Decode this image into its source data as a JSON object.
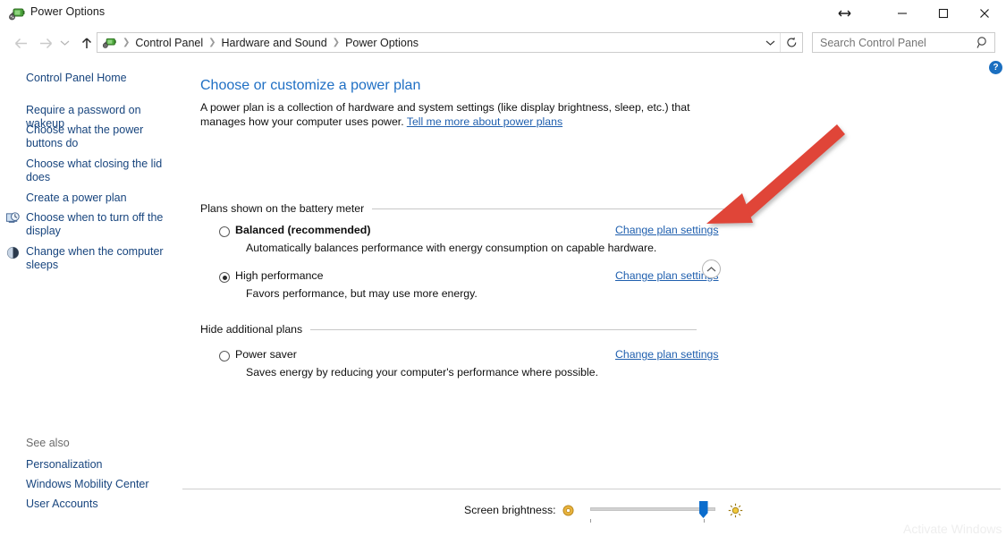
{
  "window": {
    "title": "Power Options",
    "title_icon": "power-plug-battery-icon",
    "caption": {
      "resize_label": "↔",
      "minimize_label": "—",
      "maximize_label": "□",
      "close_label": "✕"
    }
  },
  "nav": {
    "back_label": "←",
    "forward_label": "→",
    "recent_label": "⌄",
    "up_label": "↑",
    "breadcrumbs": [
      "Control Panel",
      "Hardware and Sound",
      "Power Options"
    ],
    "separator": "❯",
    "dropdown_label": "⌄",
    "refresh_label": "↻"
  },
  "search": {
    "placeholder": "Search Control Panel",
    "value": "",
    "icon": "search-icon"
  },
  "help": {
    "label": "?"
  },
  "sidebar": {
    "home_label": "Control Panel Home",
    "items": [
      {
        "label": "Require a password on wakeup",
        "icon": null
      },
      {
        "label": "Choose what the power buttons do",
        "icon": null
      },
      {
        "label": "Choose what closing the lid does",
        "icon": null
      },
      {
        "label": "Create a power plan",
        "icon": null
      },
      {
        "label": "Choose when to turn off the display",
        "icon": "monitor-clock-icon"
      },
      {
        "label": "Change when the computer sleeps",
        "icon": "moon-sleep-icon"
      }
    ],
    "see_also_label": "See also",
    "see_also_items": [
      "Personalization",
      "Windows Mobility Center",
      "User Accounts"
    ]
  },
  "main": {
    "title": "Choose or customize a power plan",
    "intro_text": "A power plan is a collection of hardware and system settings (like display brightness, sleep, etc.) that manages how your computer uses power. ",
    "intro_link": "Tell me more about power plans",
    "group_battery_label": "Plans shown on the battery meter",
    "group_additional_label": "Hide additional plans",
    "collapse_icon": "chevron-up-icon",
    "change_link_label": "Change plan settings",
    "plans": [
      {
        "name": "Balanced (recommended)",
        "description": "Automatically balances performance with energy consumption on capable hardware.",
        "selected": false,
        "bold": true
      },
      {
        "name": "High performance",
        "description": "Favors performance, but may use more energy.",
        "selected": true,
        "bold": false
      },
      {
        "name": "Power saver",
        "description": "Saves energy by reducing your computer's performance where possible.",
        "selected": false,
        "bold": false
      }
    ]
  },
  "bottom": {
    "brightness_label": "Screen brightness:",
    "brightness_icon": "brightness-dial-icon",
    "brightness_percent": 87,
    "sun_icon": "sun-icon"
  },
  "annotation": {
    "arrow_color": "#e04438",
    "arrow_name": "red-pointer-arrow"
  },
  "watermark": {
    "text": "Activate Windows"
  },
  "colors": {
    "link_blue": "#1f5fae",
    "heading_blue": "#1f6fc4",
    "sidebar_blue": "#18457e",
    "accent_red": "#e04438",
    "slider_blue": "#0a6ccc"
  }
}
